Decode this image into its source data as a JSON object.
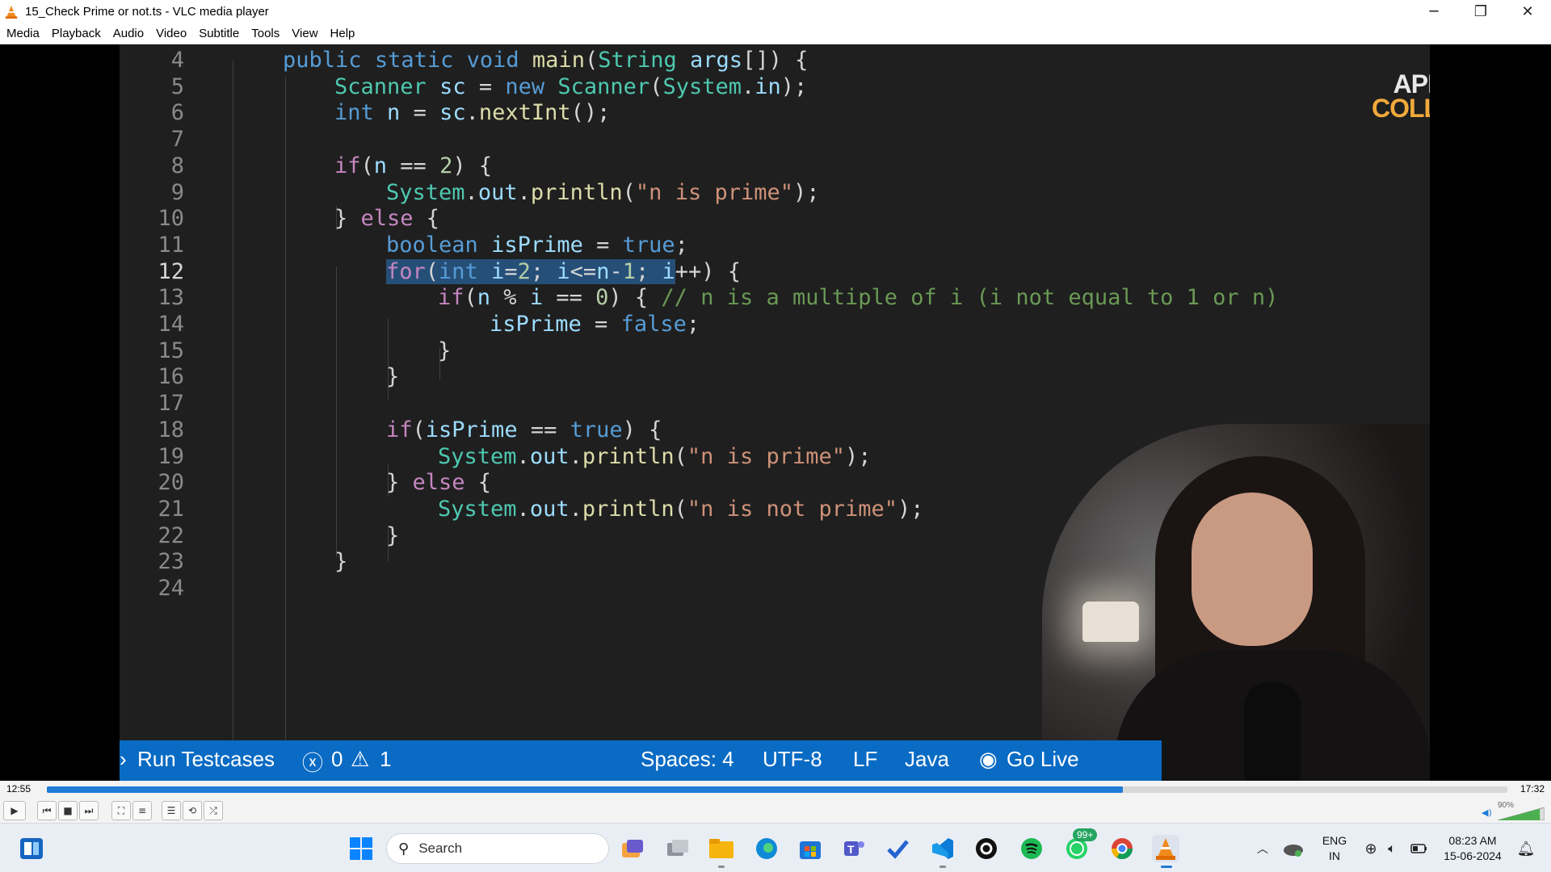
{
  "window": {
    "title": "15_Check Prime or not.ts - VLC media player",
    "controls": [
      "─",
      "❐",
      "✕"
    ]
  },
  "menu": [
    "Media",
    "Playback",
    "Audio",
    "Video",
    "Subtitle",
    "Tools",
    "View",
    "Help"
  ],
  "video": {
    "logo_line1": "APNA",
    "logo_line2": "COLLEGE",
    "code": [
      {
        "n": "4",
        "text": "public static void main(String args[]) {"
      },
      {
        "n": "5",
        "text": "Scanner sc = new Scanner(System.in);"
      },
      {
        "n": "6",
        "text": "int n = sc.nextInt();"
      },
      {
        "n": "7",
        "text": ""
      },
      {
        "n": "8",
        "text": "if(n == 2) {"
      },
      {
        "n": "9",
        "text": "System.out.println(\"n is prime\");"
      },
      {
        "n": "10",
        "text": "} else {"
      },
      {
        "n": "11",
        "text": "boolean isPrime = true;"
      },
      {
        "n": "12",
        "text": "for(int i=2; i<=n-1; i++) {"
      },
      {
        "n": "13",
        "text": "if(n % i == 0) { // n is a multiple of i (i not equal to 1 or n)"
      },
      {
        "n": "14",
        "text": "isPrime = false;"
      },
      {
        "n": "15",
        "text": "}"
      },
      {
        "n": "16",
        "text": "}"
      },
      {
        "n": "17",
        "text": ""
      },
      {
        "n": "18",
        "text": "if(isPrime == true) {"
      },
      {
        "n": "19",
        "text": "System.out.println(\"n is prime\");"
      },
      {
        "n": "20",
        "text": "} else {"
      },
      {
        "n": "21",
        "text": "System.out.println(\"n is not prime\");"
      },
      {
        "n": "22",
        "text": "}"
      },
      {
        "n": "23",
        "text": "}"
      },
      {
        "n": "24",
        "text": ""
      }
    ],
    "statusbar": {
      "run": "Run Testcases",
      "errors": "0",
      "warnings": "1",
      "spaces": "Spaces: 4",
      "encoding": "UTF-8",
      "eol": "LF",
      "language": "Java",
      "golive": "Go Live"
    }
  },
  "player": {
    "elapsed": "12:55",
    "total": "17:32",
    "progress_fraction": 0.7365,
    "volume_label": "90%",
    "volume_fraction": 0.9
  },
  "taskbar": {
    "search_label": "Search",
    "whatsapp_badge": "99+",
    "lang_line1": "ENG",
    "lang_line2": "IN",
    "time": "08:23 AM",
    "date": "15-06-2024"
  },
  "colors": {
    "editor_bg": "#1f1f1f",
    "statusbar_bg": "#0a6bc4",
    "seek_fill": "#1e7bd6",
    "logo_accent": "#f2a93b"
  }
}
